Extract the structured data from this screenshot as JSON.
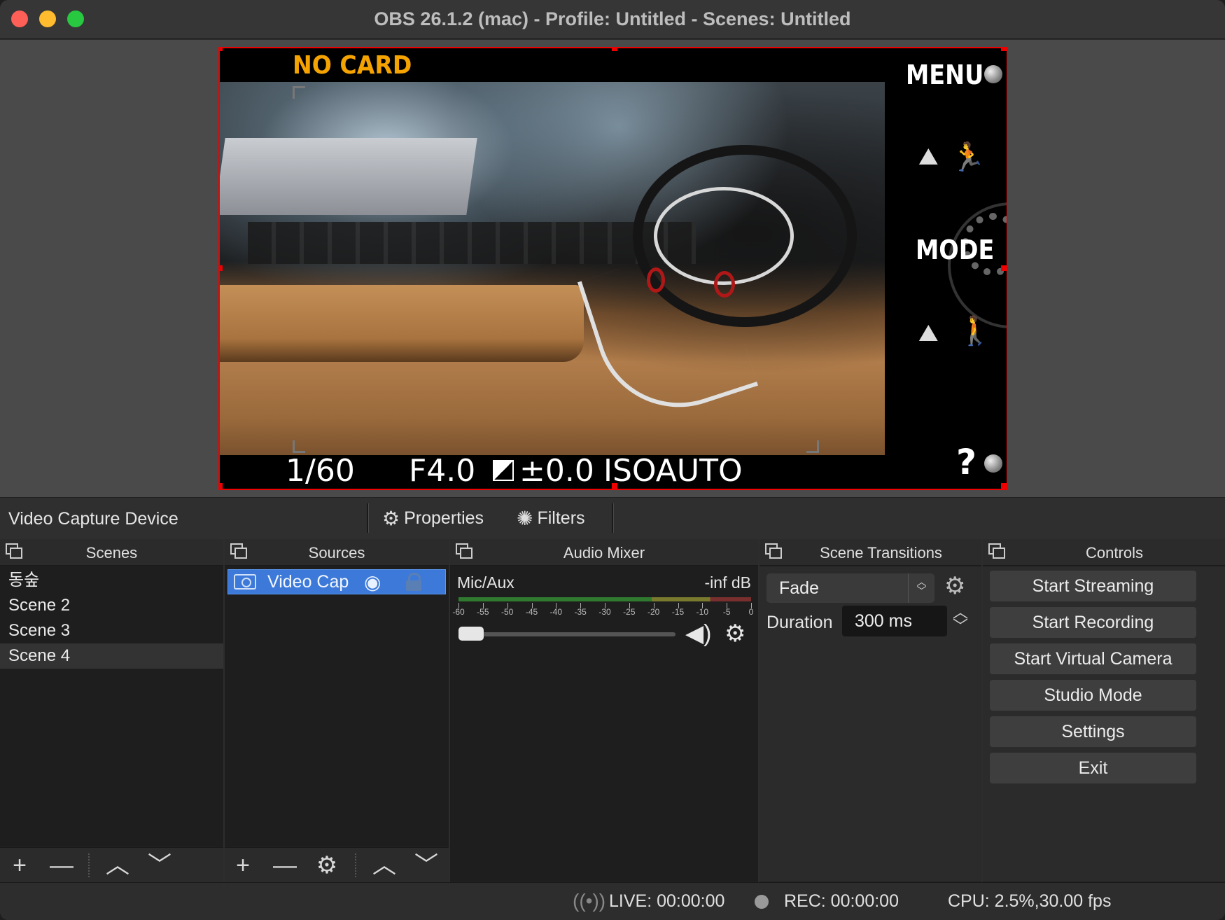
{
  "window": {
    "title": "OBS 26.1.2 (mac) - Profile: Untitled - Scenes: Untitled"
  },
  "preview": {
    "overlay": {
      "no_card": "NO CARD",
      "menu": "MENU",
      "mode": "MODE",
      "shutter": "1/60",
      "aperture": "F4.0",
      "exposure": "±0.0",
      "iso": "ISOAUTO",
      "help": "?"
    }
  },
  "source_toolbar": {
    "selected_source": "Video Capture Device",
    "properties_label": "Properties",
    "filters_label": "Filters"
  },
  "docks": {
    "scenes": {
      "title": "Scenes",
      "items": [
        "동숲",
        "Scene 2",
        "Scene 3",
        "Scene 4"
      ],
      "selected": "Scene 4"
    },
    "sources": {
      "title": "Sources",
      "items": [
        {
          "name": "Video Capture Device",
          "display": "Video Cap",
          "visible": true,
          "locked": false
        }
      ]
    },
    "audio_mixer": {
      "title": "Audio Mixer",
      "channel": {
        "name": "Mic/Aux",
        "level": "-inf dB"
      },
      "scale": [
        "-60",
        "-55",
        "-50",
        "-45",
        "-40",
        "-35",
        "-30",
        "-25",
        "-20",
        "-15",
        "-10",
        "-5",
        "0"
      ]
    },
    "transitions": {
      "title": "Scene Transitions",
      "selected": "Fade",
      "duration_label": "Duration",
      "duration_value": "300 ms"
    },
    "controls": {
      "title": "Controls",
      "buttons": [
        "Start Streaming",
        "Start Recording",
        "Start Virtual Camera",
        "Studio Mode",
        "Settings",
        "Exit"
      ]
    }
  },
  "status": {
    "live": "LIVE: 00:00:00",
    "rec": "REC: 00:00:00",
    "cpu": "CPU: 2.5%,30.00 fps"
  },
  "icons": {
    "plus": "+",
    "minus": "—",
    "up": "︿",
    "down": "﹀",
    "gear": "⚙",
    "eye": "◉",
    "speaker": "🔊",
    "live": "((•))"
  }
}
